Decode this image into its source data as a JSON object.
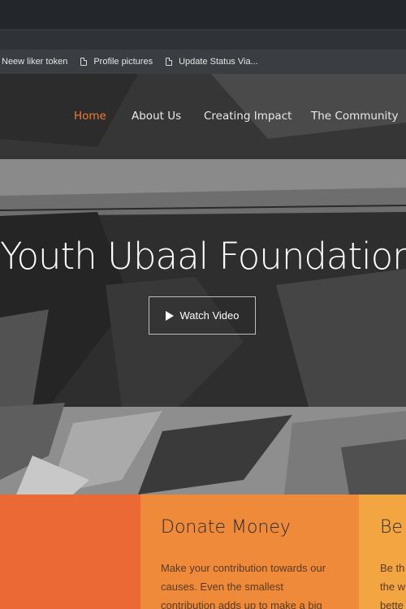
{
  "bookmarks": [
    {
      "label": "Neew liker token",
      "icon": "none"
    },
    {
      "label": "Profile pictures",
      "icon": "document-icon"
    },
    {
      "label": "Update Status Via...",
      "icon": "document-icon"
    }
  ],
  "nav": {
    "items": [
      "Home",
      "About Us",
      "Creating Impact",
      "The Community"
    ],
    "active_color": "#f27a35"
  },
  "hero": {
    "title": "Youth Ubaal Foundation",
    "button": "Watch Video"
  },
  "cards": {
    "donate": {
      "title": "Donate Money",
      "lines": [
        "Make your contribution towards our",
        "causes. Even the smallest",
        "contribution adds up to make a big"
      ]
    },
    "partial": {
      "title": "Be a",
      "lines": [
        "Be th",
        "the w",
        "bette"
      ]
    }
  },
  "colors": {
    "card_left": "#ea6934",
    "card_mid": "#ef8a3b",
    "card_right": "#f2a540"
  }
}
